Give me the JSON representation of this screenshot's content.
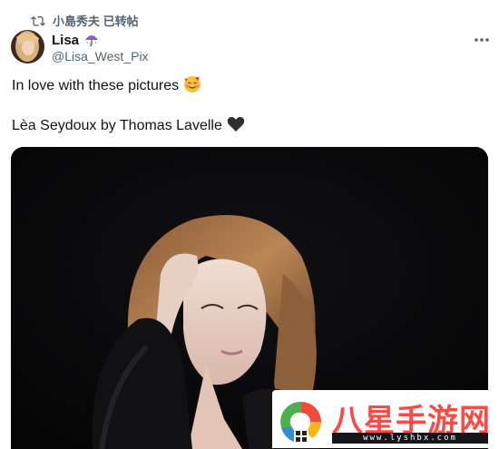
{
  "social_context": {
    "text": "小島秀夫 已转帖"
  },
  "author": {
    "display_name": "Lisa",
    "handle": "@Lisa_West_Pix"
  },
  "tweet": {
    "line1": "In love with these pictures",
    "line1_emoji": "🥰",
    "line2": "Lèa Seydoux by Thomas Lavelle",
    "line2_emoji": "🖤"
  },
  "watermark": {
    "title": "八星手游网",
    "url": "www.lyshbx.com"
  },
  "colors": {
    "text": "#0f1419",
    "secondary": "#536471",
    "watermark_red": "#ff4a43"
  },
  "icons": {
    "retweet": "retweet-icon",
    "more": "more-horizontal-icon",
    "umbrella": "umbrella-icon"
  }
}
